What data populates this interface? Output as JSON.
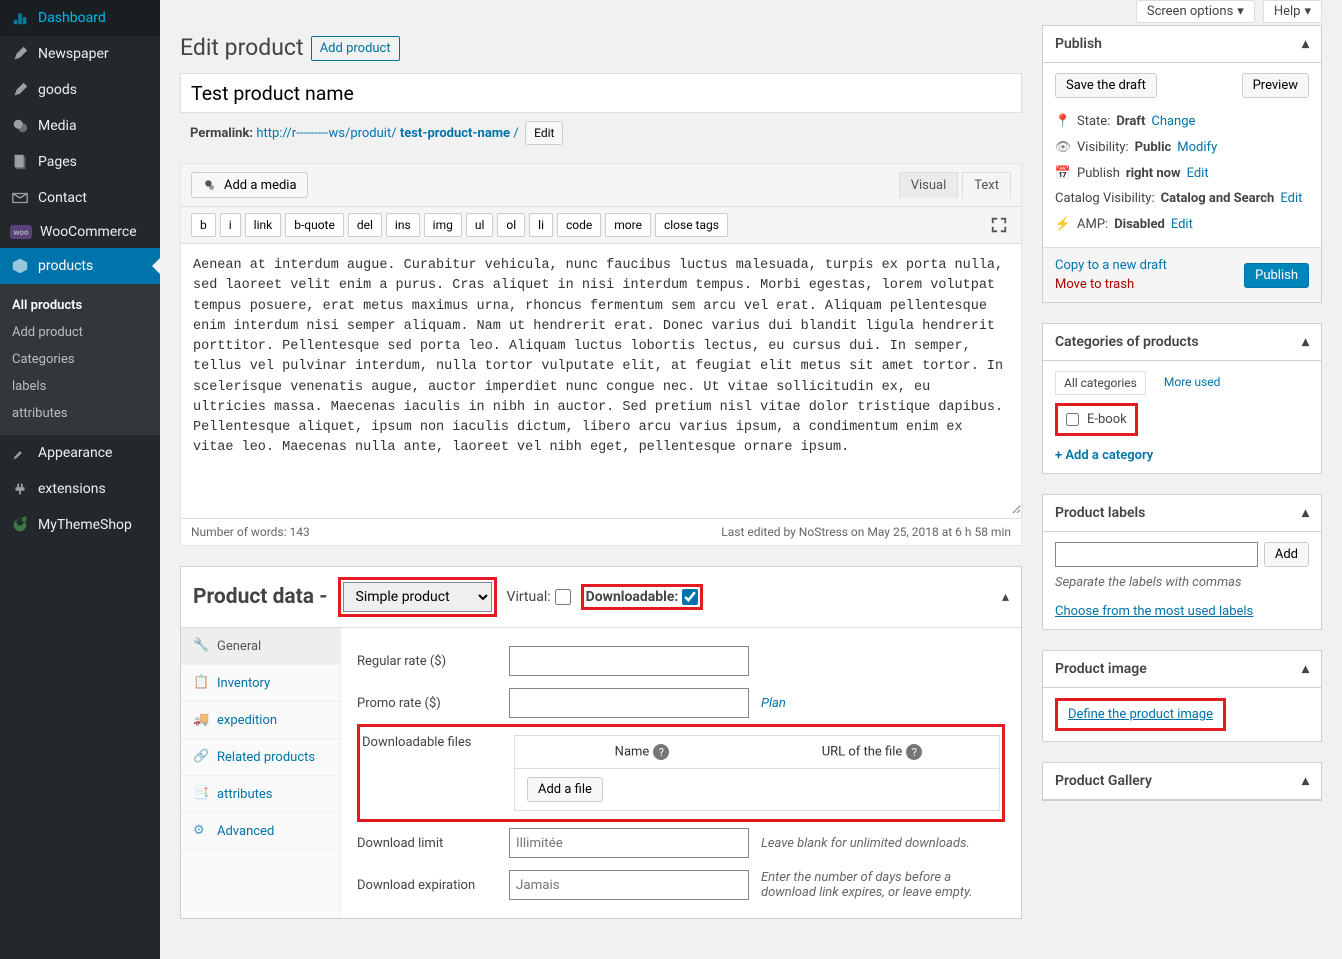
{
  "topbar": {
    "screen_options": "Screen options",
    "help": "Help"
  },
  "sidebar": {
    "items": [
      {
        "label": "Dashboard"
      },
      {
        "label": "Newspaper"
      },
      {
        "label": "goods"
      },
      {
        "label": "Media"
      },
      {
        "label": "Pages"
      },
      {
        "label": "Contact"
      },
      {
        "label": "WooCommerce"
      },
      {
        "label": "products"
      }
    ],
    "subitems": [
      {
        "label": "All products"
      },
      {
        "label": "Add product"
      },
      {
        "label": "Categories"
      },
      {
        "label": "labels"
      },
      {
        "label": "attributes"
      }
    ],
    "after": [
      {
        "label": "Appearance"
      },
      {
        "label": "extensions"
      },
      {
        "label": "MyThemeShop"
      }
    ]
  },
  "header": {
    "title": "Edit product",
    "add": "Add product"
  },
  "post": {
    "title_value": "Test product name",
    "permalink_label": "Permalink:",
    "permalink_base": "http://r---------ws/produit/",
    "permalink_slug": "test-product-name",
    "permalink_sep": "/",
    "edit": "Edit"
  },
  "editor": {
    "add_media": "Add a media",
    "tabs": {
      "visual": "Visual",
      "text": "Text"
    },
    "qtags": [
      "b",
      "i",
      "link",
      "b-quote",
      "del",
      "ins",
      "img",
      "ul",
      "ol",
      "li",
      "code",
      "more",
      "close tags"
    ],
    "body": "Aenean at interdum augue. Curabitur vehicula, nunc faucibus luctus malesuada, turpis ex porta nulla, sed laoreet velit enim a purus. Cras aliquet in nisi interdum tempus. Morbi egestas, lorem volutpat tempus posuere, erat metus maximus urna, rhoncus fermentum sem arcu vel erat. Aliquam pellentesque enim interdum nisi semper aliquam. Nam ut hendrerit erat. Donec varius dui blandit ligula hendrerit porttitor. Pellentesque sed porta leo. Aliquam luctus lobortis lectus, eu cursus dui. In semper, tellus vel pulvinar interdum, nulla tortor vulputate elit, at feugiat elit metus sit amet tortor. In scelerisque venenatis augue, auctor imperdiet nunc congue nec. Ut vitae sollicitudin ex, eu ultricies massa. Maecenas iaculis in nibh in auctor. Sed pretium nisl vitae dolor tristique dapibus. Pellentesque aliquet, ipsum non iaculis dictum, libero arcu varius ipsum, a condimentum enim ex vitae leo. Maecenas nulla ante, laoreet vel nibh eget, pellentesque ornare ipsum.",
    "wordcount_label": "Number of words:",
    "wordcount": "143",
    "last_edited": "Last edited by NoStress on May 25, 2018 at 6 h 58 min"
  },
  "product_data": {
    "title": "Product data",
    "type_value": "Simple product",
    "virtual_label": "Virtual:",
    "downloadable_label": "Downloadable:",
    "downloadable_checked": true,
    "tabs": [
      {
        "label": "General"
      },
      {
        "label": "Inventory"
      },
      {
        "label": "expedition"
      },
      {
        "label": "Related products"
      },
      {
        "label": "attributes"
      },
      {
        "label": "Advanced"
      }
    ],
    "regular_label": "Regular rate ($)",
    "promo_label": "Promo rate ($)",
    "plan_link": "Plan",
    "down_files_label": "Downloadable files",
    "down_col_name": "Name",
    "down_col_url": "URL of the file",
    "add_file": "Add a file",
    "down_limit_label": "Download limit",
    "down_limit_ph": "Illimitée",
    "down_limit_desc": "Leave blank for unlimited downloads.",
    "down_exp_label": "Download expiration",
    "down_exp_ph": "Jamais",
    "down_exp_desc": "Enter the number of days before a download link expires, or leave empty."
  },
  "publish": {
    "title": "Publish",
    "save_draft": "Save the draft",
    "preview": "Preview",
    "state_label": "State:",
    "state_value": "Draft",
    "change": "Change",
    "visibility_label": "Visibility:",
    "visibility_value": "Public",
    "modify": "Modify",
    "pub_label": "Publish",
    "pub_value": "right now",
    "edit": "Edit",
    "catalog_label": "Catalog Visibility:",
    "catalog_value": "Catalog and Search",
    "amp_label": "AMP:",
    "amp_value": "Disabled",
    "copy": "Copy to a new draft",
    "trash": "Move to trash",
    "publish_btn": "Publish"
  },
  "categories": {
    "title": "Categories of products",
    "tab_all": "All categories",
    "tab_used": "More used",
    "item": "E-book",
    "add": "+ Add a category"
  },
  "labels_box": {
    "title": "Product labels",
    "add": "Add",
    "sep_hint": "Separate the labels with commas",
    "choose": "Choose from the most used labels"
  },
  "image_box": {
    "title": "Product image",
    "define": "Define the product image"
  },
  "gallery_box": {
    "title": "Product Gallery"
  }
}
